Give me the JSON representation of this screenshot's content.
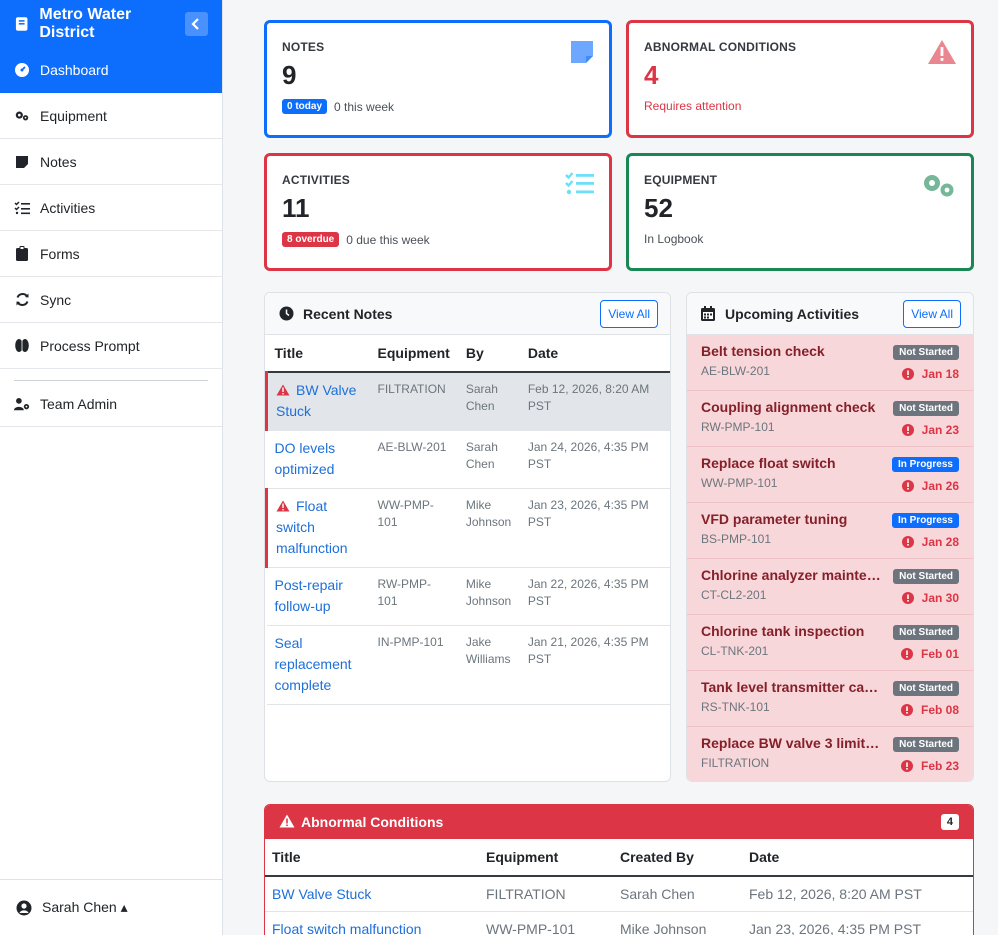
{
  "sidebar": {
    "brand": "Metro Water District",
    "items": [
      {
        "label": "Dashboard",
        "icon": "dashboard-icon"
      },
      {
        "label": "Equipment",
        "icon": "gears-icon"
      },
      {
        "label": "Notes",
        "icon": "note-icon"
      },
      {
        "label": "Activities",
        "icon": "list-check-icon"
      },
      {
        "label": "Forms",
        "icon": "clipboard-icon"
      },
      {
        "label": "Sync",
        "icon": "sync-icon"
      },
      {
        "label": "Process Prompt",
        "icon": "brain-icon"
      }
    ],
    "admin": {
      "label": "Team Admin",
      "icon": "user-gear-icon"
    },
    "user": {
      "name": "Sarah Chen ▴",
      "icon": "user-circle-icon"
    }
  },
  "stats": {
    "notes": {
      "label": "NOTES",
      "value": "9",
      "badge": "0 today",
      "sub": "0 this week",
      "color": "#0d6efd"
    },
    "abnormal": {
      "label": "ABNORMAL CONDITIONS",
      "value": "4",
      "sub": "Requires attention",
      "color": "#dc3545"
    },
    "activities": {
      "label": "ACTIVITIES",
      "value": "11",
      "badge": "8 overdue",
      "sub": "0 due this week",
      "color": "#dc3545"
    },
    "equipment": {
      "label": "EQUIPMENT",
      "value": "52",
      "sub": "In Logbook",
      "color": "#198754"
    }
  },
  "recent_notes": {
    "title": "Recent Notes",
    "view_all": "View All",
    "columns": [
      "Title",
      "Equipment",
      "By",
      "Date"
    ],
    "rows": [
      {
        "title": "BW Valve Stuck",
        "equipment": "FILTRATION",
        "by": "Sarah Chen",
        "date": "Feb 12, 2026, 8:20 AM PST",
        "alert": true,
        "selected": true
      },
      {
        "title": "DO levels optimized",
        "equipment": "AE-BLW-201",
        "by": "Sarah Chen",
        "date": "Jan 24, 2026, 4:35 PM PST",
        "alert": false,
        "selected": false
      },
      {
        "title": "Float switch malfunction",
        "equipment": "WW-PMP-101",
        "by": "Mike Johnson",
        "date": "Jan 23, 2026, 4:35 PM PST",
        "alert": true,
        "selected": false
      },
      {
        "title": "Post-repair follow-up",
        "equipment": "RW-PMP-101",
        "by": "Mike Johnson",
        "date": "Jan 22, 2026, 4:35 PM PST",
        "alert": false,
        "selected": false
      },
      {
        "title": "Seal replacement complete",
        "equipment": "IN-PMP-101",
        "by": "Jake Williams",
        "date": "Jan 21, 2026, 4:35 PM PST",
        "alert": false,
        "selected": false
      }
    ]
  },
  "upcoming": {
    "title": "Upcoming Activities",
    "view_all": "View All",
    "items": [
      {
        "title": "Belt tension check",
        "equipment": "AE-BLW-201",
        "status": "Not Started",
        "due": "Jan 18"
      },
      {
        "title": "Coupling alignment check",
        "equipment": "RW-PMP-101",
        "status": "Not Started",
        "due": "Jan 23"
      },
      {
        "title": "Replace float switch",
        "equipment": "WW-PMP-101",
        "status": "In Progress",
        "due": "Jan 26"
      },
      {
        "title": "VFD parameter tuning",
        "equipment": "BS-PMP-101",
        "status": "In Progress",
        "due": "Jan 28"
      },
      {
        "title": "Chlorine analyzer mainte…",
        "equipment": "CT-CL2-201",
        "status": "Not Started",
        "due": "Jan 30"
      },
      {
        "title": "Chlorine tank inspection",
        "equipment": "CL-TNK-201",
        "status": "Not Started",
        "due": "Feb 01"
      },
      {
        "title": "Tank level transmitter cali…",
        "equipment": "RS-TNK-101",
        "status": "Not Started",
        "due": "Feb 08"
      },
      {
        "title": "Replace BW valve 3 limit …",
        "equipment": "FILTRATION",
        "status": "Not Started",
        "due": "Feb 23"
      }
    ],
    "status_colors": {
      "Not Started": "#6c757d",
      "In Progress": "#0d6efd"
    }
  },
  "abnormal_table": {
    "title": "Abnormal Conditions",
    "count": "4",
    "columns": [
      "Title",
      "Equipment",
      "Created By",
      "Date"
    ],
    "rows": [
      {
        "title": "BW Valve Stuck",
        "equipment": "FILTRATION",
        "by": "Sarah Chen",
        "date": "Feb 12, 2026, 8:20 AM PST"
      },
      {
        "title": "Float switch malfunction",
        "equipment": "WW-PMP-101",
        "by": "Mike Johnson",
        "date": "Jan 23, 2026, 4:35 PM PST"
      }
    ]
  }
}
